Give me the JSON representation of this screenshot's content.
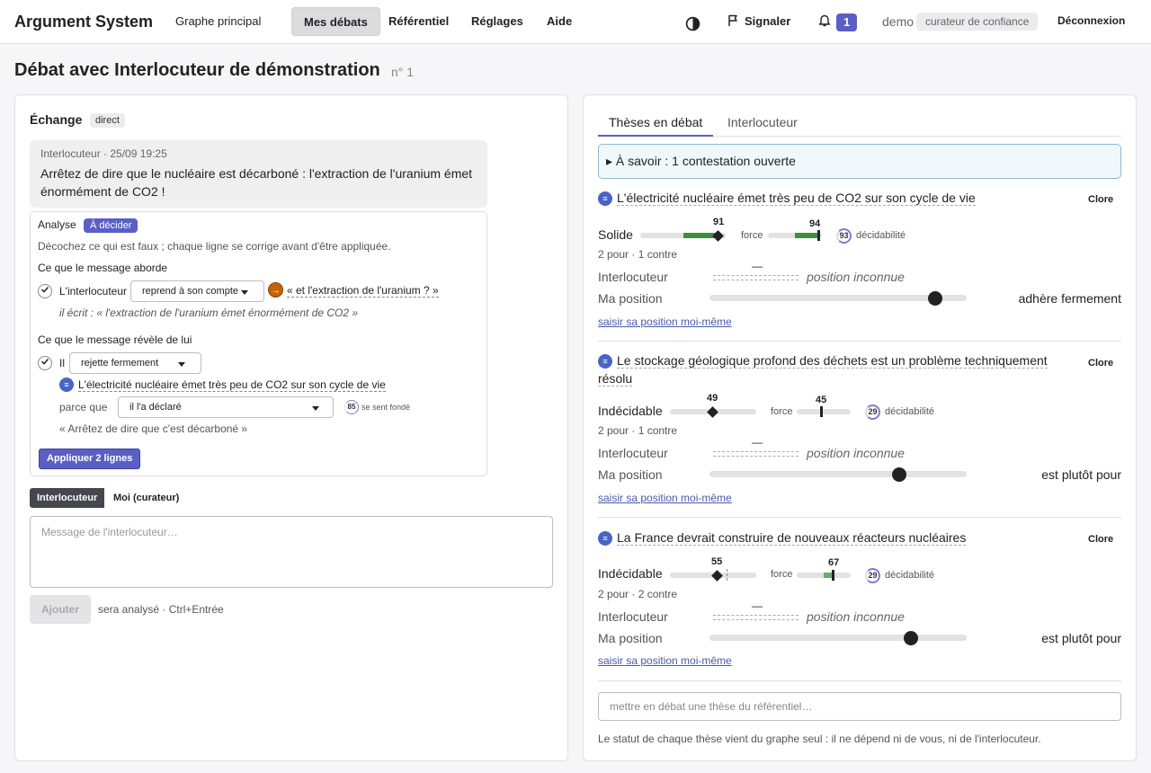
{
  "app": {
    "title": "Argument System"
  },
  "nav": {
    "graph": "Graphe principal",
    "debates": "Mes débats",
    "referential": "Référentiel",
    "settings": "Réglages",
    "help": "Aide"
  },
  "header_right": {
    "report": "Signaler",
    "notif_count": "1",
    "user": "demo",
    "role": "curateur de confiance",
    "logout": "Déconnexion"
  },
  "page": {
    "title": "Débat avec Interlocuteur de démonstration",
    "number": "n° 1"
  },
  "left": {
    "title": "Échange",
    "mode_tag": "direct",
    "message": {
      "meta": "Interlocuteur · 25/09 19:25",
      "text": "Arrêtez de dire que le nucléaire est décarboné : l'extraction de l'uranium émet énormément de CO2 !"
    },
    "analysis": {
      "label": "Analyse",
      "status": "À décider",
      "hint": "Décochez ce qui est faux ; chaque ligne se corrige avant d'être appliquée.",
      "section1": "Ce que le message aborde",
      "row1": {
        "subject": "L'interlocuteur",
        "select": "reprend à son compte",
        "quote": "« et l'extraction de l'uranium ? »",
        "written": "il écrit : « l'extraction de l'uranium émet énormément de CO2 »"
      },
      "section2": "Ce que le message révèle de lui",
      "row2": {
        "subject": "Il",
        "select": "rejette fermement",
        "thesis": "L'électricité nucléaire émet très peu de CO2 sur son cycle de vie",
        "because_label": "parce que",
        "because_select": "il l'a déclaré",
        "ring_value": "85",
        "ring_label": "se sent fondé",
        "quote": "« Arrêtez de dire que c'est décarboné »"
      },
      "apply": "Appliquer 2 lignes"
    },
    "speaker_toggle": [
      "Interlocuteur",
      "Moi (curateur)"
    ],
    "input_placeholder": "Message de l'interlocuteur…",
    "add_button": "Ajouter",
    "add_hint": "sera analysé · Ctrl+Entrée"
  },
  "right": {
    "tabs": [
      "Thèses en débat",
      "Interlocuteur"
    ],
    "info": "▸ À savoir : 1 contestation ouverte",
    "theses": [
      {
        "title": "L'électricité nucléaire émet très peu de CO2 sur son cycle de vie",
        "close": "Clore",
        "status": "Solide",
        "value": "91",
        "force_label": "force",
        "force": "94",
        "decidability": "93",
        "decidability_label": "décidabilité",
        "counts": "2 pour · 1 contre",
        "interlocutor_label": "Interlocuteur",
        "interlocutor_dash": "—",
        "interlocutor_pos": "position inconnue",
        "my_label": "Ma position",
        "my_pos": "adhère fermement",
        "link": "saisir sa position moi-même"
      },
      {
        "title": "Le stockage géologique profond des déchets est un problème techniquement résolu",
        "close": "Clore",
        "status": "Indécidable",
        "value": "49",
        "force_label": "force",
        "force": "45",
        "decidability": "29",
        "decidability_label": "décidabilité",
        "counts": "2 pour · 1 contre",
        "interlocutor_label": "Interlocuteur",
        "interlocutor_dash": "—",
        "interlocutor_pos": "position inconnue",
        "my_label": "Ma position",
        "my_pos": "est plutôt pour",
        "link": "saisir sa position moi-même"
      },
      {
        "title": "La France devrait construire de nouveaux réacteurs nucléaires",
        "close": "Clore",
        "status": "Indécidable",
        "value": "55",
        "force_label": "force",
        "force": "67",
        "decidability": "29",
        "decidability_label": "décidabilité",
        "counts": "2 pour · 2 contre",
        "interlocutor_label": "Interlocuteur",
        "interlocutor_dash": "—",
        "interlocutor_pos": "position inconnue",
        "my_label": "Ma position",
        "my_pos": "est plutôt pour",
        "link": "saisir sa position moi-même"
      }
    ],
    "add_placeholder": "mettre en débat une thèse du référentiel…",
    "footer": "Le statut de chaque thèse vient du graphe seul : il ne dépend ni de vous, ni de l'interlocuteur."
  },
  "colors": {
    "accent": "#5a5fc4",
    "solid_green": "#3f8e3f",
    "thesis_icon": "#4a64c4",
    "orange": "#c3640a"
  },
  "icons": [
    "contrast-icon",
    "flag-icon",
    "bell-icon",
    "thesis-icon",
    "arrow-icon",
    "check-icon"
  ]
}
